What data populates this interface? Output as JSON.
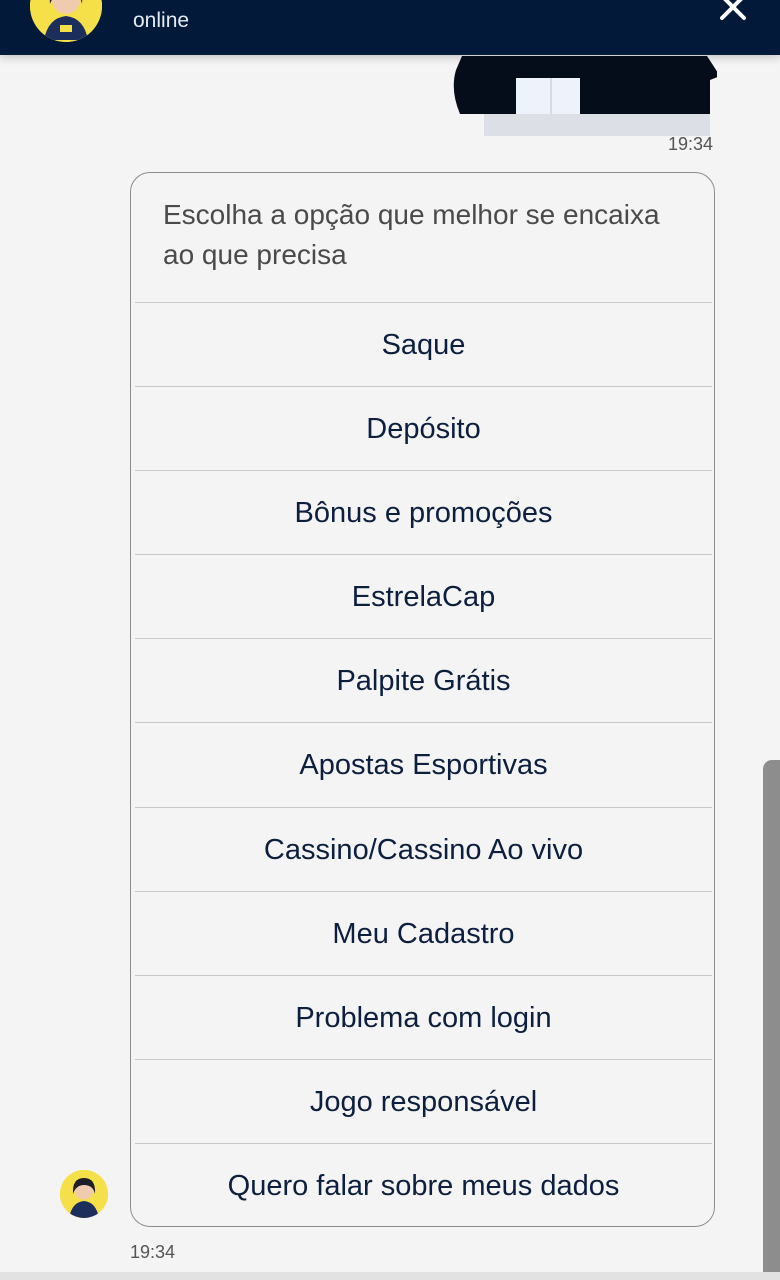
{
  "header": {
    "status": "online"
  },
  "outgoing": {
    "time": "19:34"
  },
  "bot_message": {
    "prompt": "Escolha a opção que melhor se encaixa ao que precisa",
    "options": [
      "Saque",
      "Depósito",
      "Bônus e promoções",
      "EstrelaCap",
      "Palpite Grátis",
      "Apostas Esportivas",
      "Cassino/Cassino Ao vivo",
      "Meu Cadastro",
      "Problema com login",
      "Jogo responsável",
      "Quero falar sobre meus dados"
    ],
    "time": "19:34"
  },
  "colors": {
    "header_bg": "#03193a",
    "option_text": "#0c1f3f",
    "avatar_bg": "#f5e04a"
  }
}
